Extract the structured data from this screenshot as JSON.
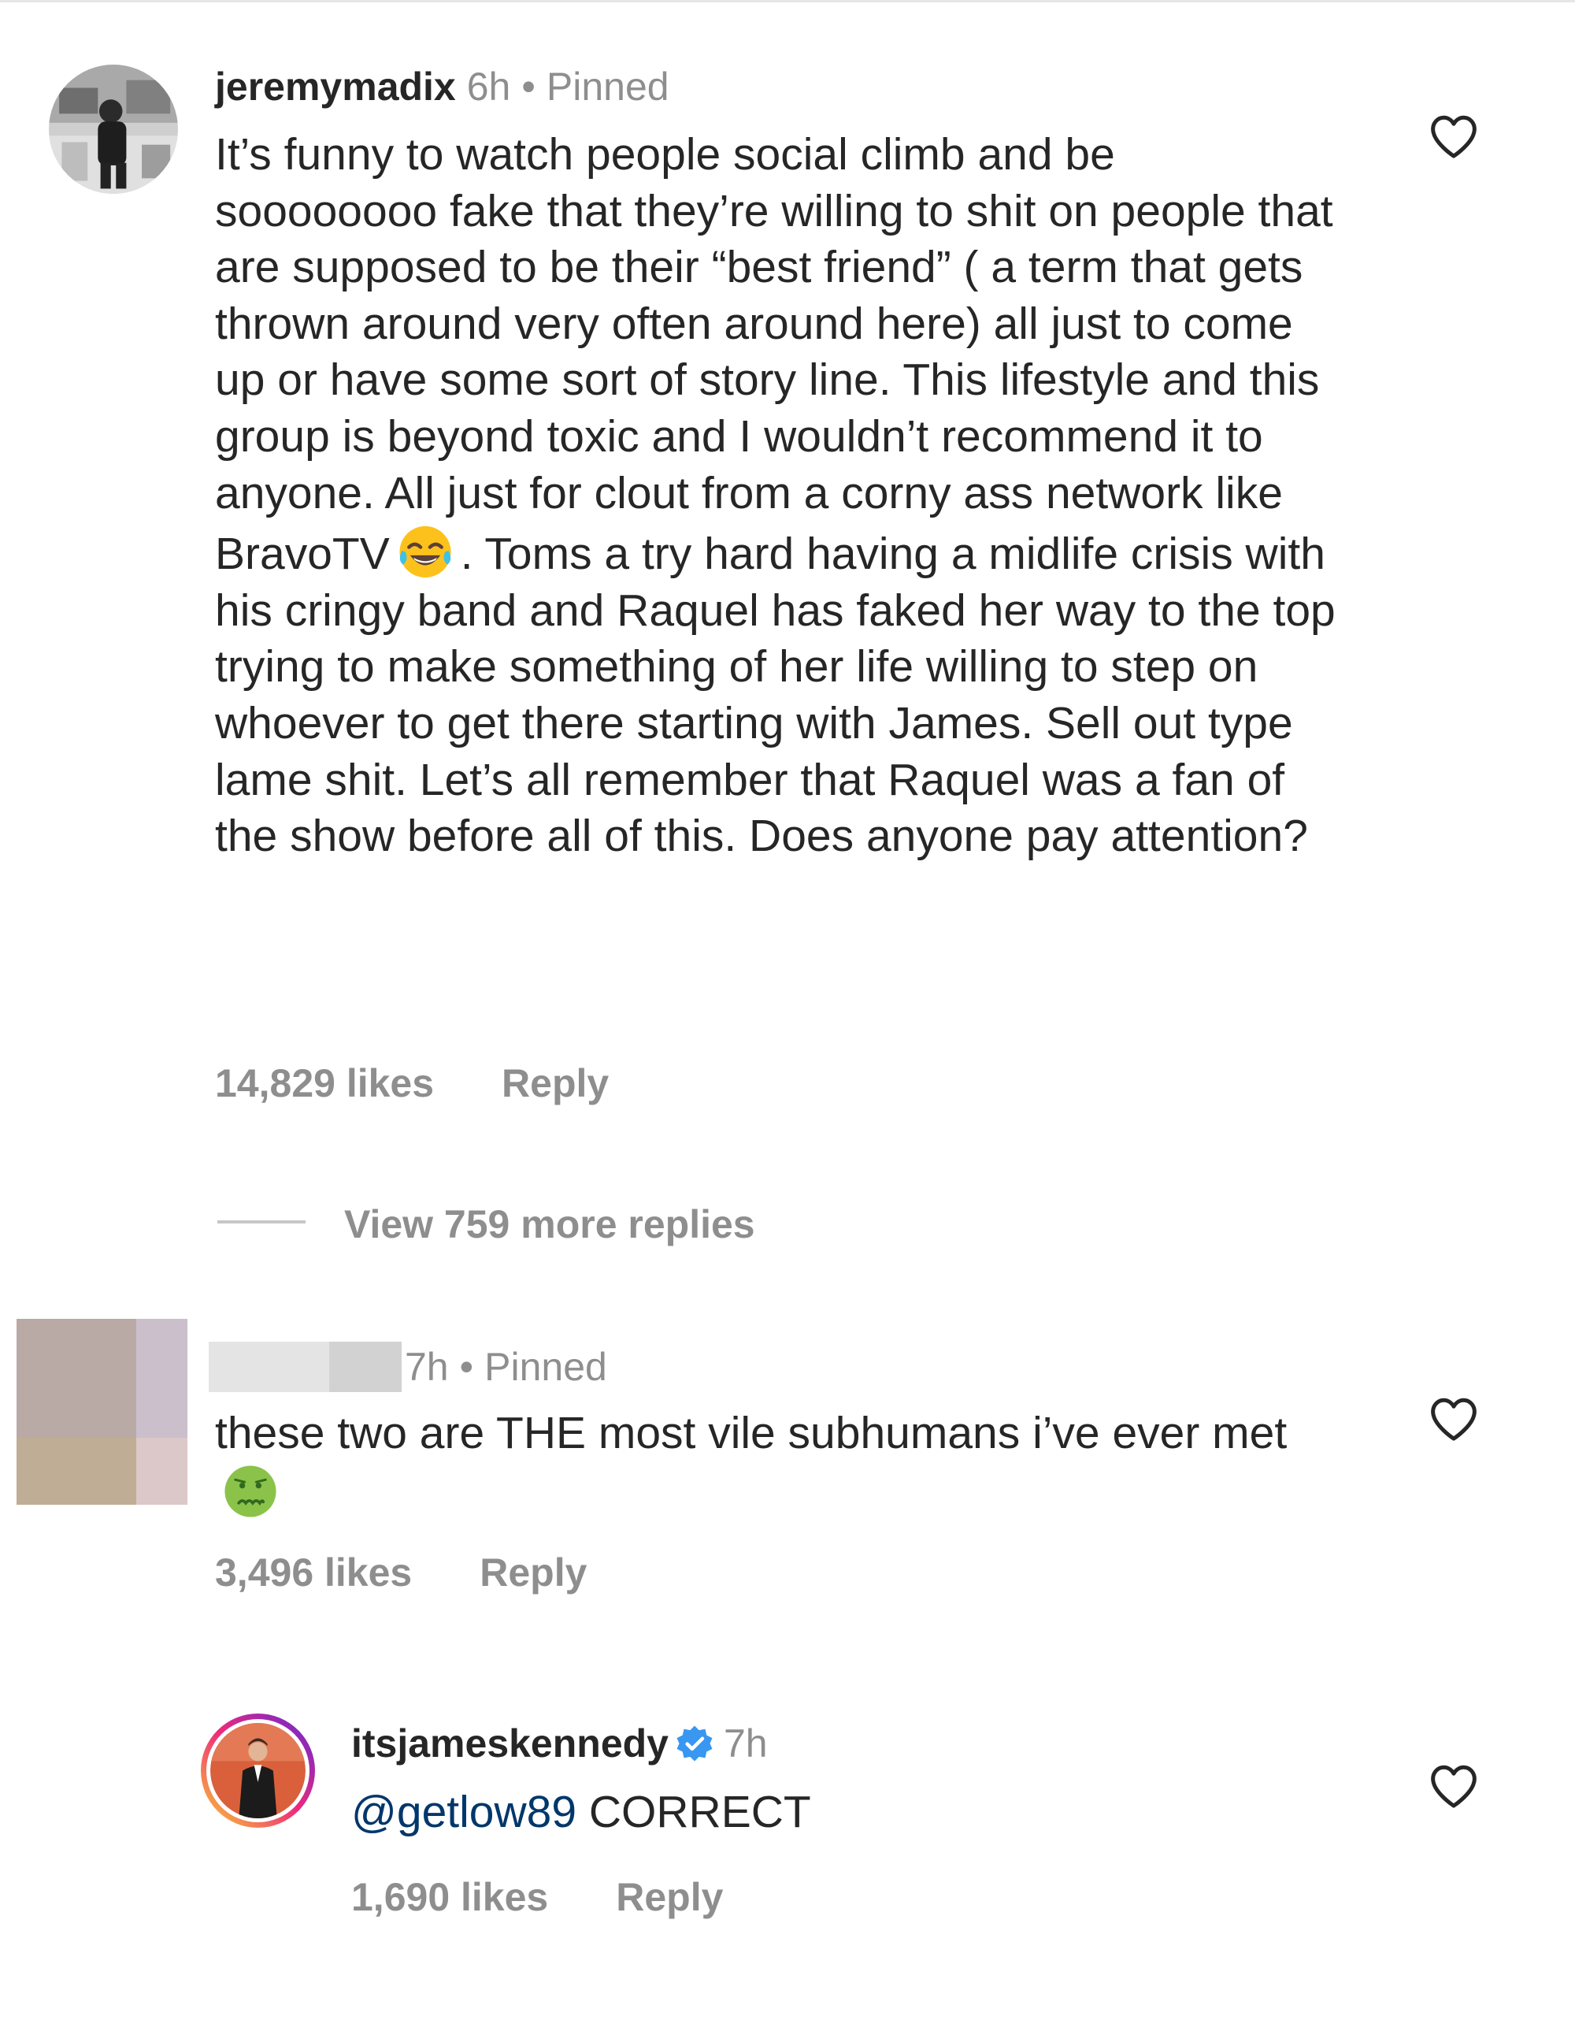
{
  "comments": [
    {
      "username": "jeremymadix",
      "time": "6h",
      "pinned_label": "Pinned",
      "text_before_emoji": "It’s funny to watch people social climb and be soooooooo fake that they’re willing to shit on people that are supposed to be their “best friend” ( a term that gets thrown around very often around here) all just to come up or have some sort of story line. This lifestyle and this group is beyond toxic and I wouldn’t recommend it to anyone. All just for clout from a corny ass network like BravoTV",
      "emoji": "face-with-tears-of-joy",
      "text_after_emoji": ". Toms  a try hard having a midlife crisis with his cringy band and Raquel has faked her way to the top trying to make something of her life willing to step on whoever to get there starting with James. Sell out type lame shit. Let’s all remember that Raquel was a fan of the show before all of this. Does anyone pay attention?",
      "likes": "14,829 likes",
      "reply_label": "Reply",
      "view_replies": "View 759 more replies"
    },
    {
      "username": "",
      "time": "7h",
      "pinned_label": "Pinned",
      "text": "these two are THE most vile subhumans i’ve ever met",
      "emoji": "nauseated-face",
      "likes": "3,496 likes",
      "reply_label": "Reply"
    },
    {
      "username": "itsjameskennedy",
      "verified": true,
      "time": "7h",
      "mention": "@getlow89",
      "text": "CORRECT",
      "likes": "1,690 likes",
      "reply_label": "Reply"
    }
  ],
  "icons": {
    "like": "heart-outline-icon",
    "verified": "verified-badge-icon"
  },
  "colors": {
    "text": "#262626",
    "secondary": "#8e8e8e",
    "mention": "#00376b",
    "verified": "#3897f0"
  }
}
